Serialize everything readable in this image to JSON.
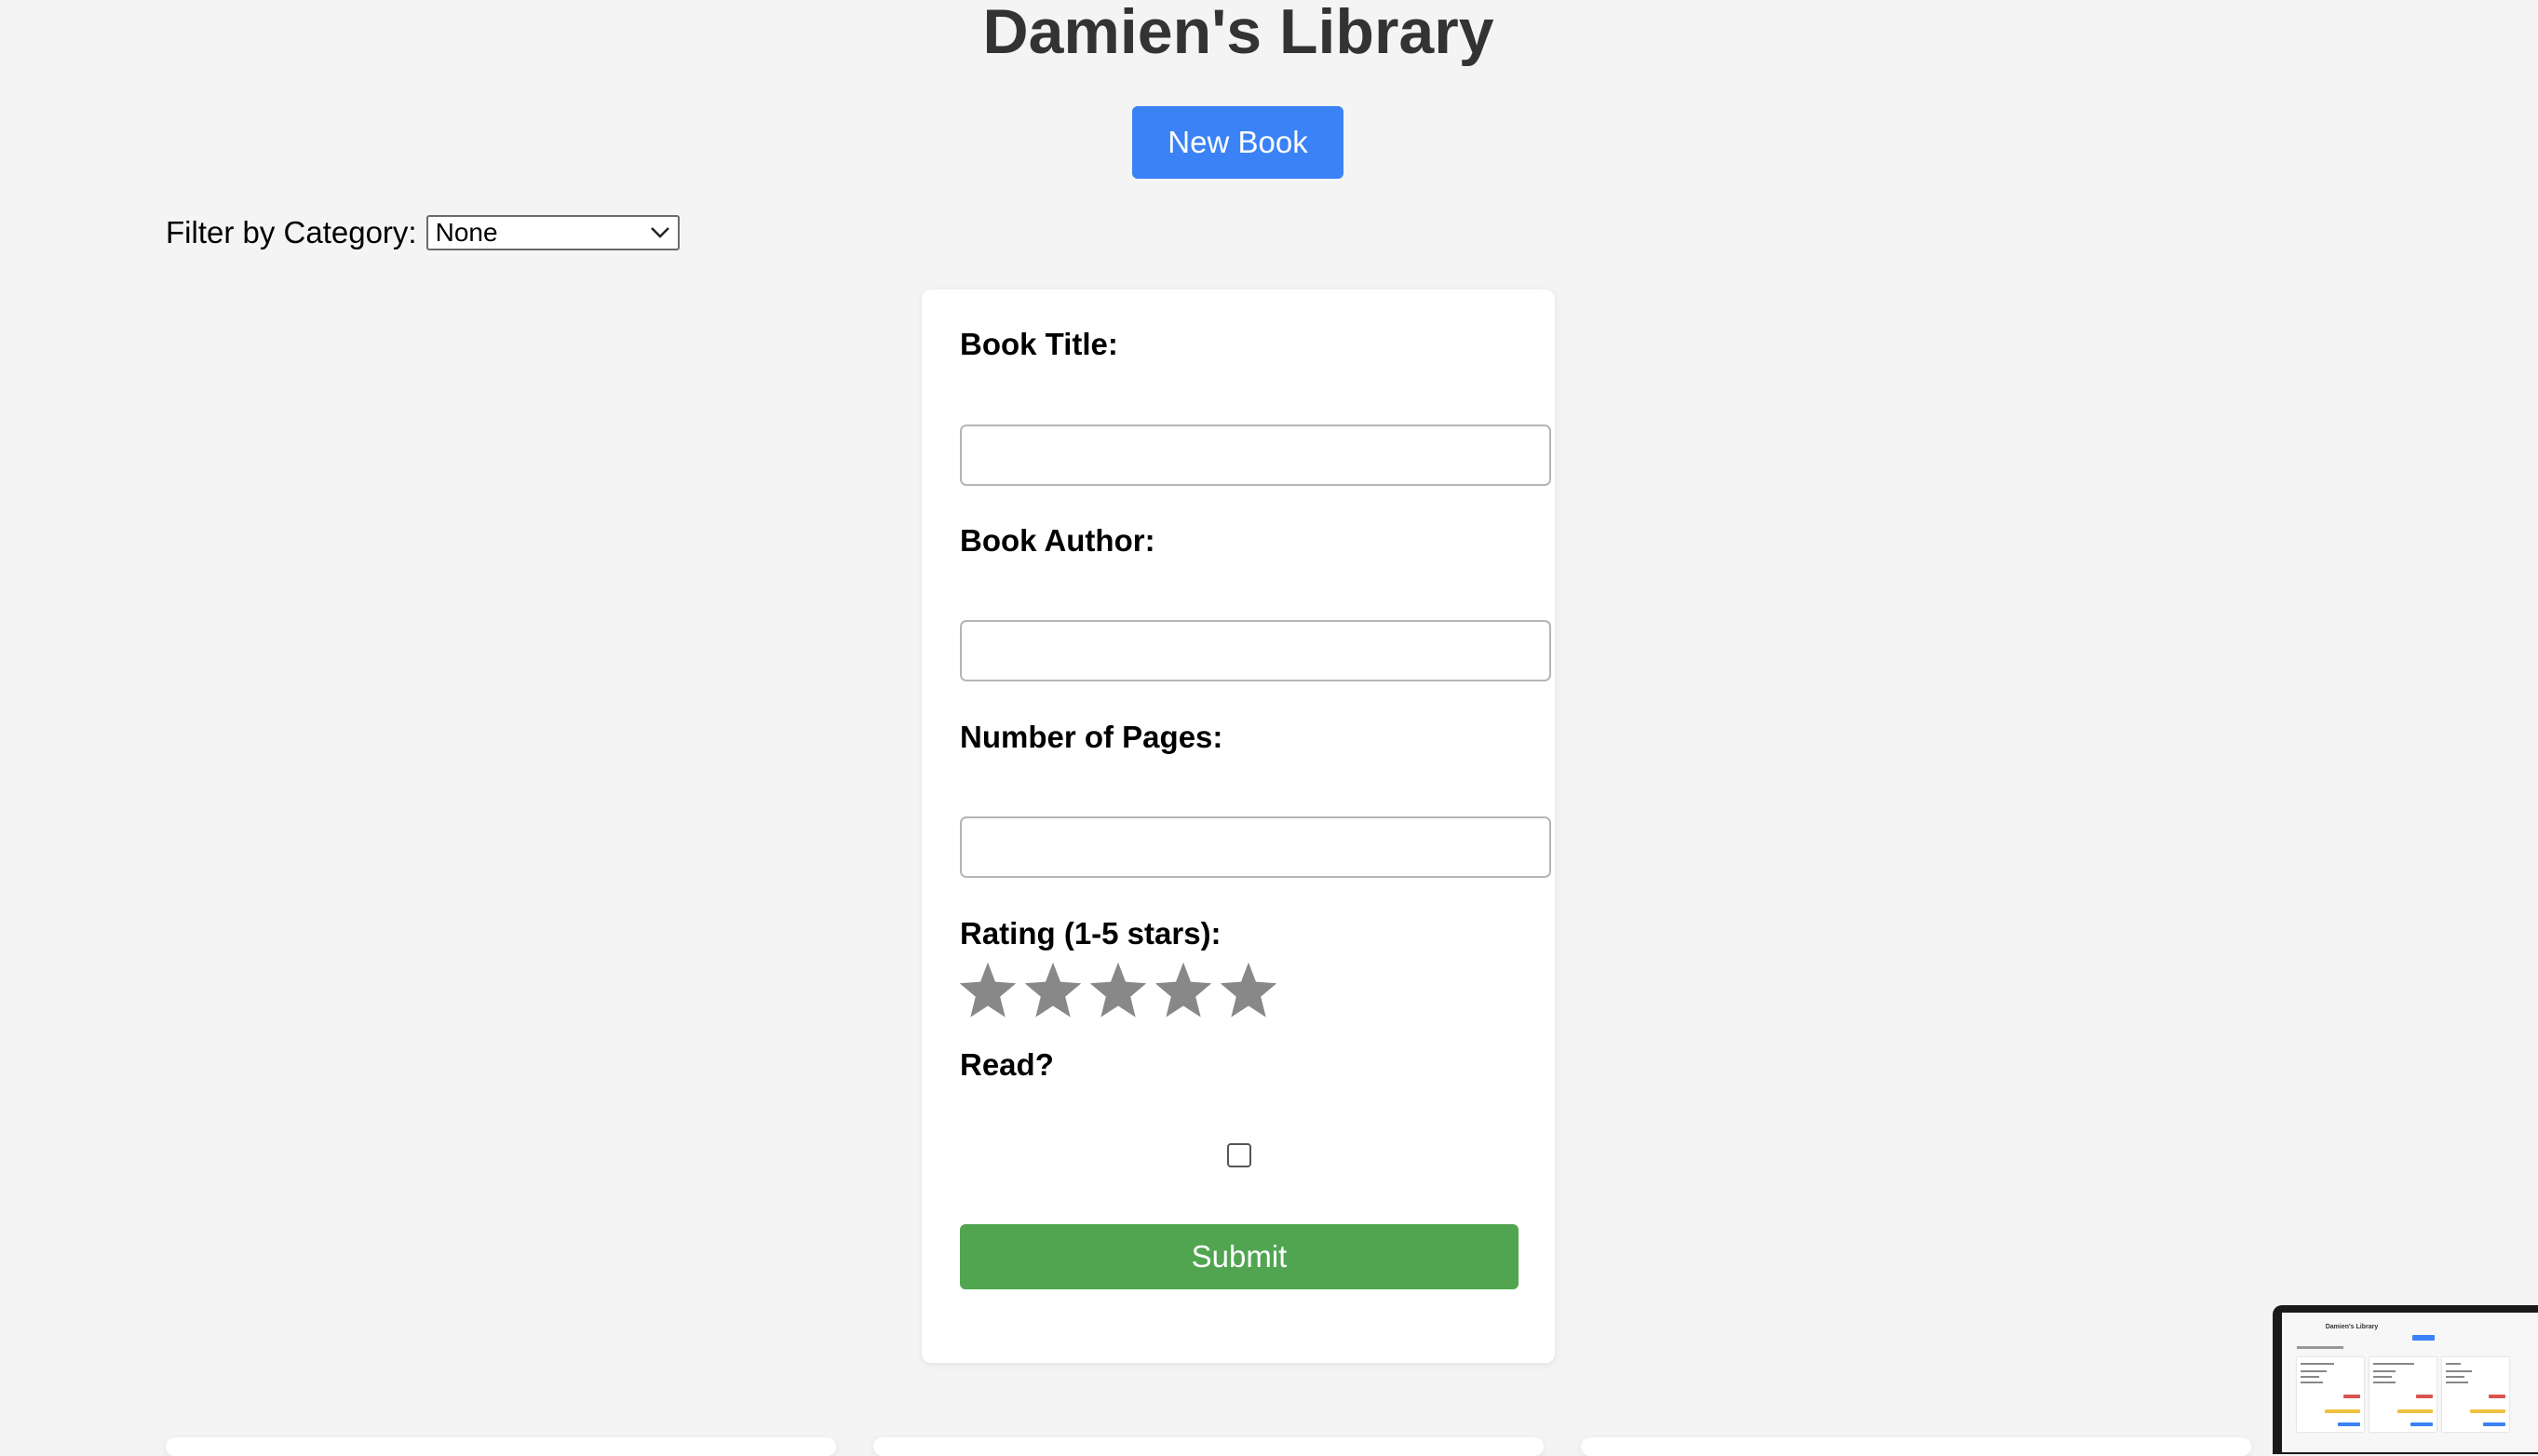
{
  "header": {
    "title": "Damien's Library",
    "new_book_label": "New Book"
  },
  "filter": {
    "label": "Filter by Category:",
    "selected": "None"
  },
  "form": {
    "title_label": "Book Title:",
    "author_label": "Book Author:",
    "pages_label": "Number of Pages:",
    "rating_label": "Rating (1-5 stars):",
    "rating_value": 0,
    "rating_max": 5,
    "read_label": "Read?",
    "read_checked": false,
    "submit_label": "Submit"
  },
  "preview": {
    "title": "Damien's Library"
  },
  "icons": {
    "star": "star-icon",
    "select_arrow": "chevron-down-icon"
  },
  "colors": {
    "primary": "#3b82f6",
    "submit": "#51a551",
    "star_empty": "#888888",
    "title_text": "#333333"
  }
}
